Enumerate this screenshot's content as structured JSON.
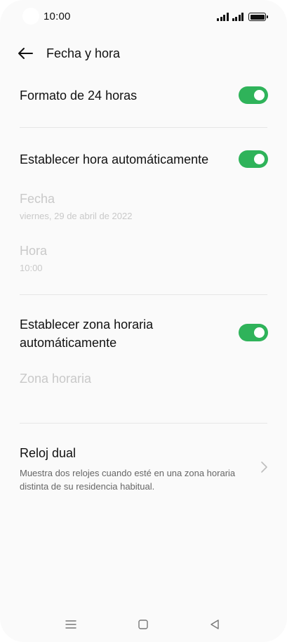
{
  "status_bar": {
    "time": "10:00"
  },
  "header": {
    "title": "Fecha y hora",
    "back_icon": "arrow-left-icon"
  },
  "settings": {
    "format_24h": {
      "label": "Formato de 24 horas",
      "enabled": true
    },
    "auto_time": {
      "label": "Establecer hora automáticamente",
      "enabled": true
    },
    "date": {
      "label": "Fecha",
      "value": "viernes, 29 de abril de 2022",
      "disabled": true
    },
    "time": {
      "label": "Hora",
      "value": "10:00",
      "disabled": true
    },
    "auto_timezone": {
      "label_line1": "Establecer zona horaria",
      "label_line2": "automáticamente",
      "enabled": true
    },
    "timezone": {
      "label": "Zona horaria",
      "disabled": true
    },
    "dual_clock": {
      "label": "Reloj dual",
      "desc_line1": "Muestra dos relojes cuando esté en una zona horaria",
      "desc_line2": "distinta de su residencia habitual."
    }
  },
  "colors": {
    "toggle_on": "#2fb35a",
    "disabled_text": "#c9c9c9"
  }
}
